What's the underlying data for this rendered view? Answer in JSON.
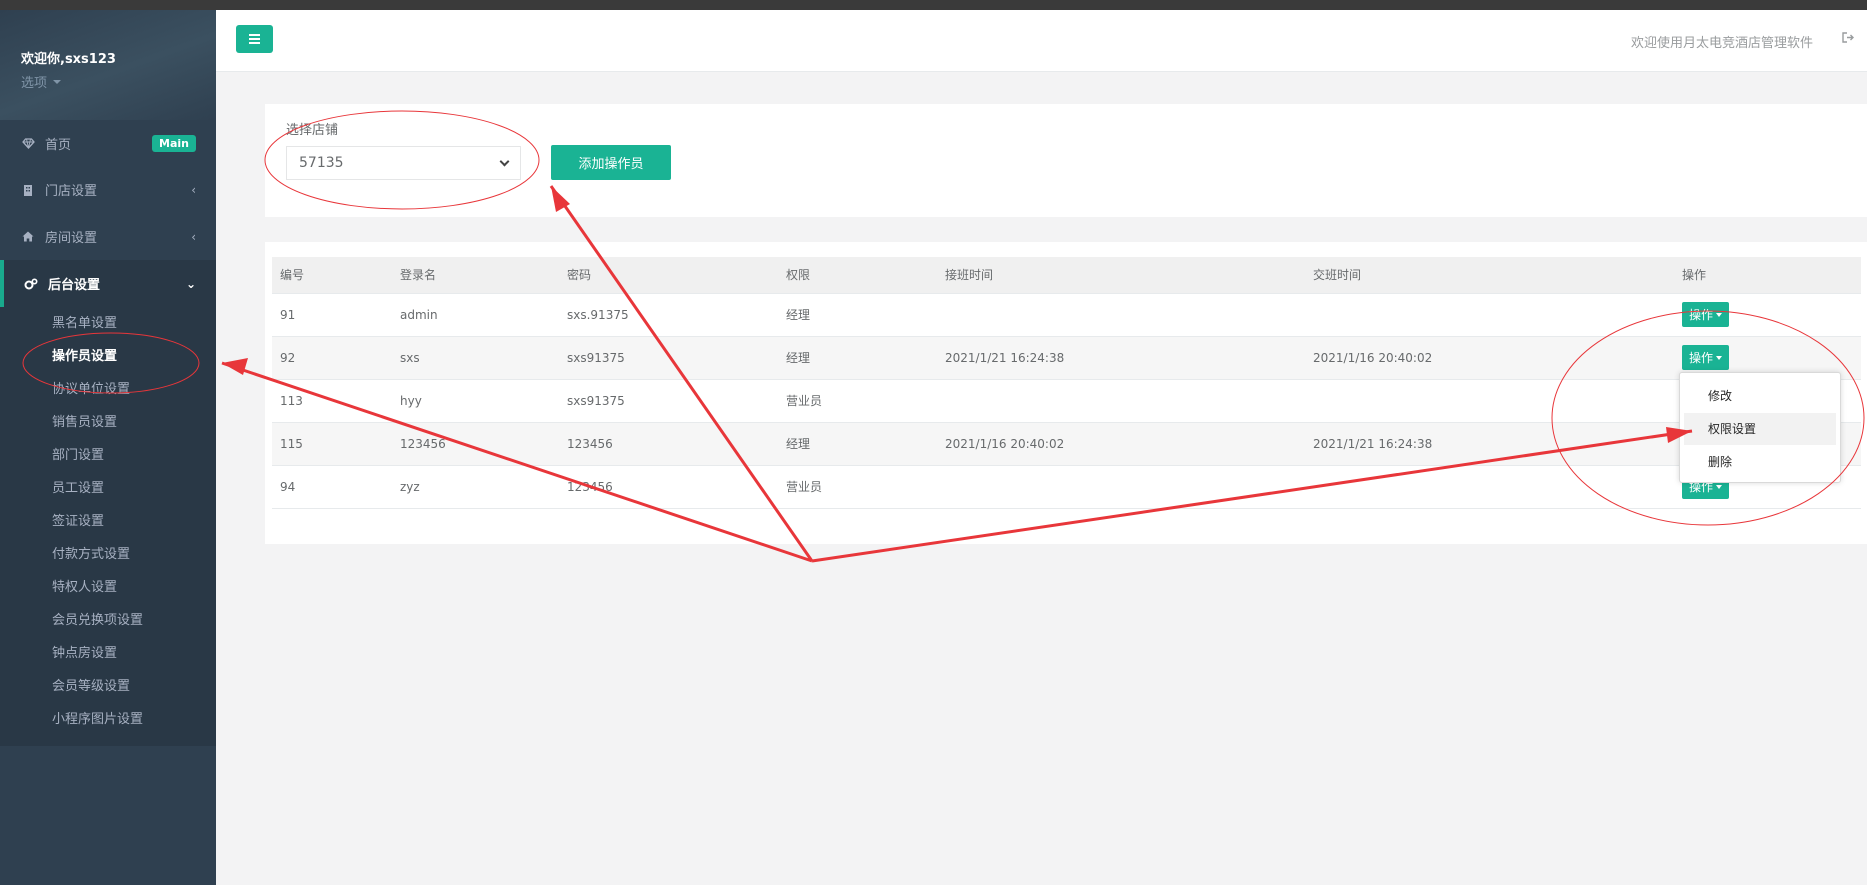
{
  "sidebar": {
    "welcome": "欢迎你,sxs123",
    "options_label": "选项",
    "nav": [
      {
        "label": "首页",
        "badge": "Main"
      },
      {
        "label": "门店设置"
      },
      {
        "label": "房间设置"
      },
      {
        "label": "后台设置"
      }
    ],
    "submenu": [
      "黑名单设置",
      "操作员设置",
      "协议单位设置",
      "销售员设置",
      "部门设置",
      "员工设置",
      "签证设置",
      "付款方式设置",
      "特权人设置",
      "会员兑换项设置",
      "钟点房设置",
      "会员等级设置",
      "小程序图片设置"
    ],
    "active_sub": "操作员设置"
  },
  "topbar": {
    "welcome_text": "欢迎使用月太电竞酒店管理软件"
  },
  "filter": {
    "label": "选择店铺",
    "store_value": "57135",
    "add_button": "添加操作员"
  },
  "table": {
    "headers": [
      "编号",
      "登录名",
      "密码",
      "权限",
      "接班时间",
      "交班时间",
      "操作"
    ],
    "rows": [
      {
        "id": "91",
        "login": "admin",
        "password": "sxs.91375",
        "role": "经理",
        "on_duty": "",
        "off_duty": "",
        "action": "操作"
      },
      {
        "id": "92",
        "login": "sxs",
        "password": "sxs91375",
        "role": "经理",
        "on_duty": "2021/1/21 16:24:38",
        "off_duty": "2021/1/16 20:40:02",
        "action": "操作"
      },
      {
        "id": "113",
        "login": "hyy",
        "password": "sxs91375",
        "role": "营业员",
        "on_duty": "",
        "off_duty": "",
        "action": ""
      },
      {
        "id": "115",
        "login": "123456",
        "password": "123456",
        "role": "经理",
        "on_duty": "2021/1/16 20:40:02",
        "off_duty": "2021/1/21 16:24:38",
        "action": ""
      },
      {
        "id": "94",
        "login": "zyz",
        "password": "123456",
        "role": "营业员",
        "on_duty": "",
        "off_duty": "",
        "action": "操作"
      }
    ]
  },
  "dropdown": {
    "items": [
      "修改",
      "权限设置",
      "删除"
    ],
    "highlighted": "权限设置"
  },
  "colors": {
    "accent": "#1ab394",
    "sidebar_bg": "#2f4050",
    "annotation_red": "#e8363a"
  }
}
